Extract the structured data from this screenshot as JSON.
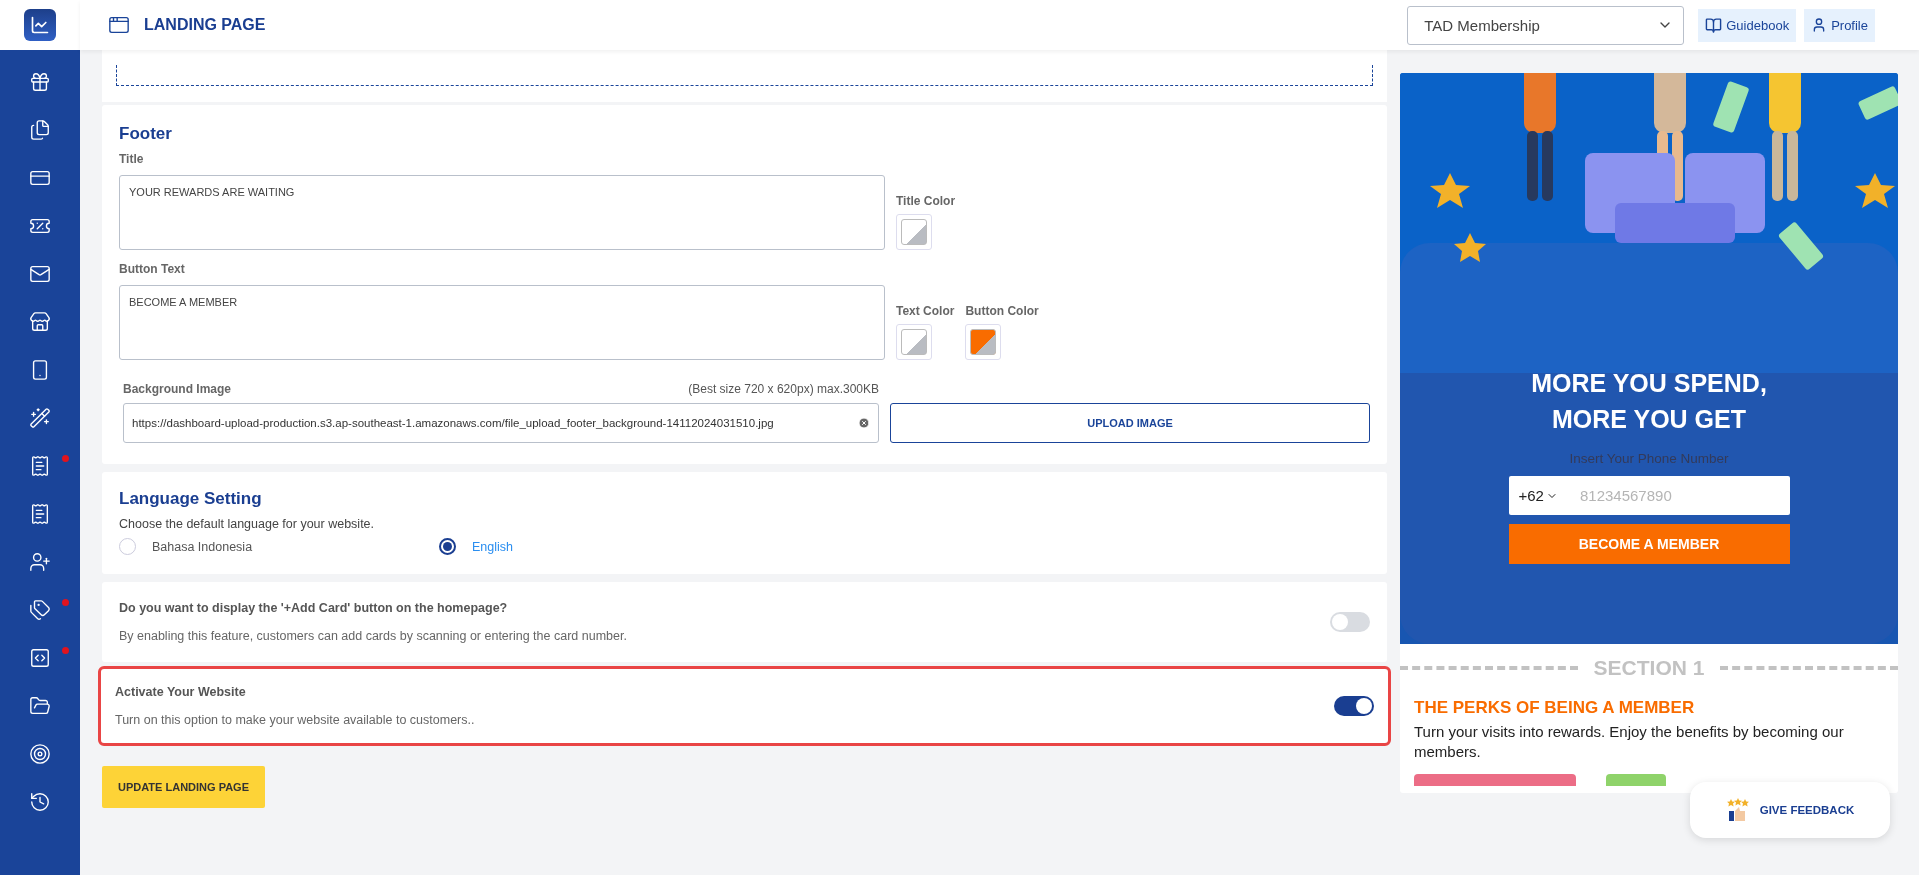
{
  "sidebar": {
    "items": [
      {
        "kind": "gift",
        "badge": false
      },
      {
        "kind": "files",
        "badge": false
      },
      {
        "kind": "card",
        "badge": false
      },
      {
        "kind": "voucher",
        "badge": false
      },
      {
        "kind": "mail",
        "badge": false
      },
      {
        "kind": "store",
        "badge": false
      },
      {
        "kind": "mobile",
        "badge": false
      },
      {
        "kind": "wand",
        "badge": false
      },
      {
        "kind": "receipt",
        "badge": true
      },
      {
        "kind": "receipt",
        "badge": false
      },
      {
        "kind": "users",
        "badge": false
      },
      {
        "kind": "tags",
        "badge": true
      },
      {
        "kind": "code",
        "badge": true
      },
      {
        "kind": "folder",
        "badge": false
      },
      {
        "kind": "target",
        "badge": false
      },
      {
        "kind": "history",
        "badge": false
      }
    ]
  },
  "header": {
    "title": "LANDING PAGE",
    "program_select": {
      "value": "TAD Membership"
    },
    "buttons": [
      {
        "label": "Guidebook",
        "kind": "book"
      },
      {
        "label": "Profile",
        "kind": "user"
      }
    ]
  },
  "footer_section": {
    "heading": "Footer",
    "title_field": {
      "label": "Title",
      "value": "YOUR REWARDS ARE WAITING"
    },
    "title_color": {
      "label": "Title Color",
      "color": "#ffffff"
    },
    "button_text_field": {
      "label": "Button Text",
      "value": "BECOME A MEMBER"
    },
    "text_color": {
      "label": "Text Color",
      "color": "#ffffff"
    },
    "button_color": {
      "label": "Button Color",
      "color": "#f96c00"
    },
    "background_image": {
      "label": "Background Image",
      "hint": "(Best size 720 x 620px) max.300KB",
      "value": "https://dashboard-upload-production.s3.ap-southeast-1.amazonaws.com/file_upload_footer_background-14112024031510.jpg",
      "upload_button": "UPLOAD IMAGE"
    }
  },
  "language": {
    "heading": "Language Setting",
    "prompt": "Choose the default language for your website.",
    "options": [
      {
        "label": "Bahasa Indonesia",
        "selected": false
      },
      {
        "label": "English",
        "selected": true
      }
    ]
  },
  "toggles": [
    {
      "title": "Do you want to display the '+Add Card' button on the homepage?",
      "description": "By enabling this feature, customers can add cards by scanning or entering the card number.",
      "on": false,
      "highlighted": false
    },
    {
      "title": "Activate Your Website",
      "description": "Turn on this option to make your website available to customers..",
      "on": true,
      "highlighted": true
    }
  ],
  "update_button": "UPDATE LANDING PAGE",
  "preview": {
    "headline": "MORE YOU SPEND, MORE YOU GET",
    "phone_label": "Insert Your Phone Number",
    "country_code": "+62",
    "phone_placeholder": "81234567890",
    "cta": "BECOME A MEMBER",
    "section_label": "SECTION 1",
    "perks_title": "THE PERKS OF BEING A MEMBER",
    "perks_text": "Turn your visits into rewards. Enjoy the benefits by becoming our members."
  },
  "feedback_button": "GIVE FEEDBACK"
}
